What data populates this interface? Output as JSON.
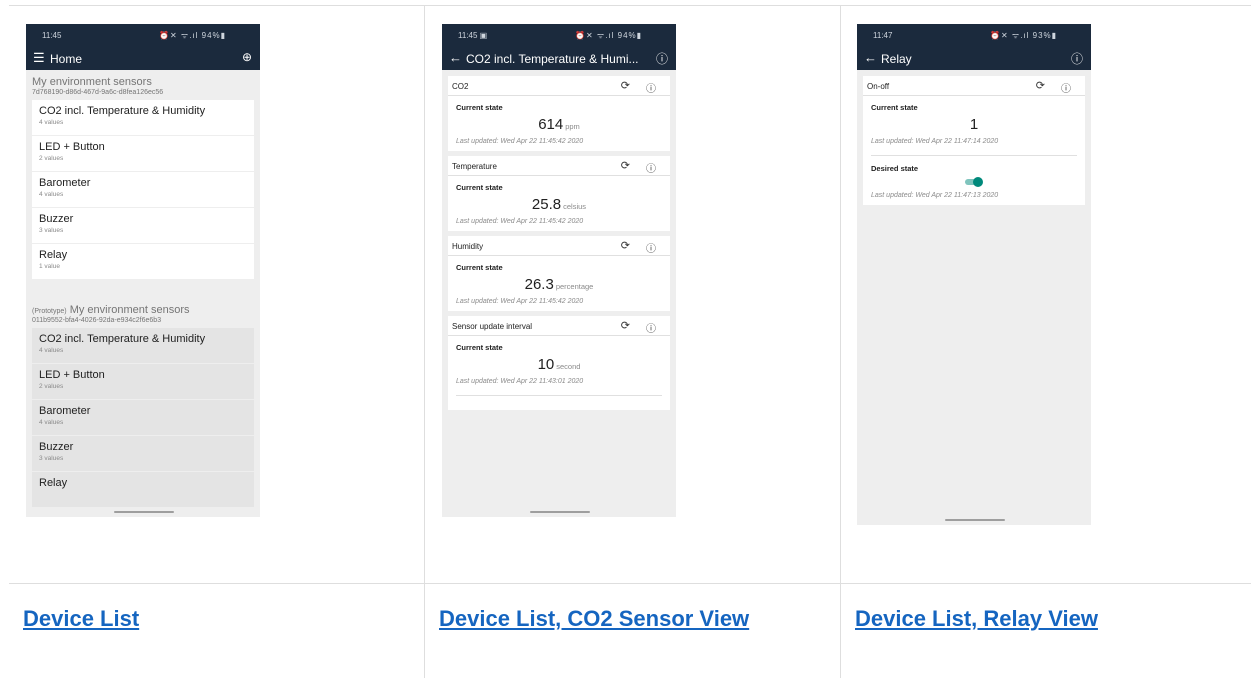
{
  "phones": {
    "home": {
      "time": "11:45",
      "status_icons": "⏰✕ ᯤ.ıl 94%▮",
      "title": "Home",
      "group1": {
        "title": "My environment sensors",
        "id": "7d768190-d86d-467d-9a6c-d8fea126ec56",
        "devices": [
          {
            "name": "CO2 incl. Temperature & Humidity",
            "values": "4 values"
          },
          {
            "name": "LED + Button",
            "values": "2 values"
          },
          {
            "name": "Barometer",
            "values": "4 values"
          },
          {
            "name": "Buzzer",
            "values": "3 values"
          },
          {
            "name": "Relay",
            "values": "1 value"
          }
        ]
      },
      "group2": {
        "prefix": "(Prototype)",
        "title": "My environment sensors",
        "id": "011b9552-bfa4-4026-92da-e934c2f6e6b3",
        "devices": [
          {
            "name": "CO2 incl. Temperature & Humidity",
            "values": "4 values"
          },
          {
            "name": "LED + Button",
            "values": "2 values"
          },
          {
            "name": "Barometer",
            "values": "4 values"
          },
          {
            "name": "Buzzer",
            "values": "3 values"
          },
          {
            "name": "Relay",
            "values": ""
          }
        ]
      }
    },
    "co2": {
      "time": "11:45 ▣",
      "status_icons": "⏰✕ ᯤ.ıl 94%▮",
      "title": "CO2 incl. Temperature & Humi...",
      "current_state_label": "Current state",
      "cards": [
        {
          "name": "CO2",
          "value": "614",
          "unit": "ppm",
          "updated": "Last updated: Wed Apr 22 11:45:42 2020"
        },
        {
          "name": "Temperature",
          "value": "25.8",
          "unit": "celsius",
          "updated": "Last updated: Wed Apr 22 11:45:42 2020"
        },
        {
          "name": "Humidity",
          "value": "26.3",
          "unit": "percentage",
          "updated": "Last updated: Wed Apr 22 11:45:42 2020"
        },
        {
          "name": "Sensor update interval",
          "value": "10",
          "unit": "second",
          "updated": "Last updated: Wed Apr 22 11:43:01 2020"
        }
      ]
    },
    "relay": {
      "time": "11:47",
      "status_icons": "⏰✕ ᯤ.ıl 93%▮",
      "title": "Relay",
      "card_name": "On-off",
      "current_state_label": "Current state",
      "current_value": "1",
      "current_updated": "Last updated: Wed Apr 22 11:47:14 2020",
      "desired_state_label": "Desired state",
      "desired_on": true,
      "desired_updated": "Last updated: Wed Apr 22 11:47:13 2020"
    }
  },
  "captions": [
    "Device List",
    "Device List, CO2 Sensor View",
    "Device List, Relay View"
  ],
  "colors": {
    "appbar": "#1b2a3d",
    "link": "#1565c0",
    "toggle": "#00897b"
  }
}
